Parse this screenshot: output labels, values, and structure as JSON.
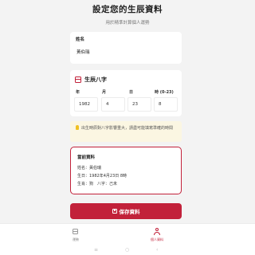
{
  "header": {
    "title": "設定您的生辰資料",
    "subtitle": "用於精準計算個人運勢"
  },
  "name_card": {
    "label": "姓名",
    "value": "黃伯瑞"
  },
  "bazi": {
    "title": "生辰八字",
    "col_labels": [
      "年",
      "月",
      "日",
      "時 (0-23)"
    ],
    "values": [
      "1982",
      "4",
      "23",
      "8"
    ]
  },
  "tip": {
    "text": "出生時辰對八字影響重大，請盡可能填寫準確的時間"
  },
  "current": {
    "title": "當前資料",
    "name_line": "姓名：黃伯瑞",
    "birth_line": "生日：1982年4月23日 8時",
    "zodiac_line": "生肖：狗　八字：己未"
  },
  "save_button": {
    "label": "保存資料"
  },
  "tabbar": {
    "items": [
      {
        "label": "運勢",
        "icon": "calendar-icon",
        "active": false
      },
      {
        "label": "個人資料",
        "icon": "user-icon",
        "active": true
      }
    ]
  },
  "colors": {
    "accent": "#c2213a",
    "tip_bg": "#fbf6e2",
    "page_bg": "#f3f3f3"
  }
}
